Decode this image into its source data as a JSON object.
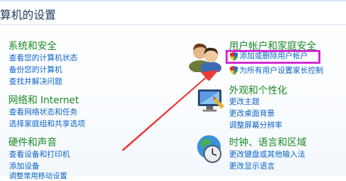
{
  "window": {
    "title": "算机的设置"
  },
  "highlight_color": "#d22bd4",
  "arrow_color": "#ec3b3b",
  "categories": [
    {
      "title": "系统和安全",
      "icon": "system-security-icon",
      "links": [
        "查看您的计算机状态",
        "备份您的计算机",
        "查找并解决问题"
      ]
    },
    {
      "title": "网络和 Internet",
      "icon": "network-icon",
      "links": [
        "查看网络状态和任务",
        "选择家庭组和共享选项"
      ]
    },
    {
      "title": "硬件和声音",
      "icon": "hardware-sound-icon",
      "links": [
        "查看设备和打印机",
        "添加设备",
        "调整常用移动设置"
      ]
    },
    {
      "title": "用户帐户和家庭安全",
      "icon": "user-accounts-icon",
      "links": [
        "添加或删除用户帐户",
        "为所有用户设置家长控制"
      ]
    },
    {
      "title": "外观和个性化",
      "icon": "appearance-icon",
      "links": [
        "更改主题",
        "更改桌面背景",
        "调整屏幕分辨率"
      ]
    },
    {
      "title": "时钟、语言和区域",
      "icon": "clock-language-region-icon",
      "links": [
        "更改键盘或其他输入法",
        "更改显示语言"
      ]
    }
  ]
}
